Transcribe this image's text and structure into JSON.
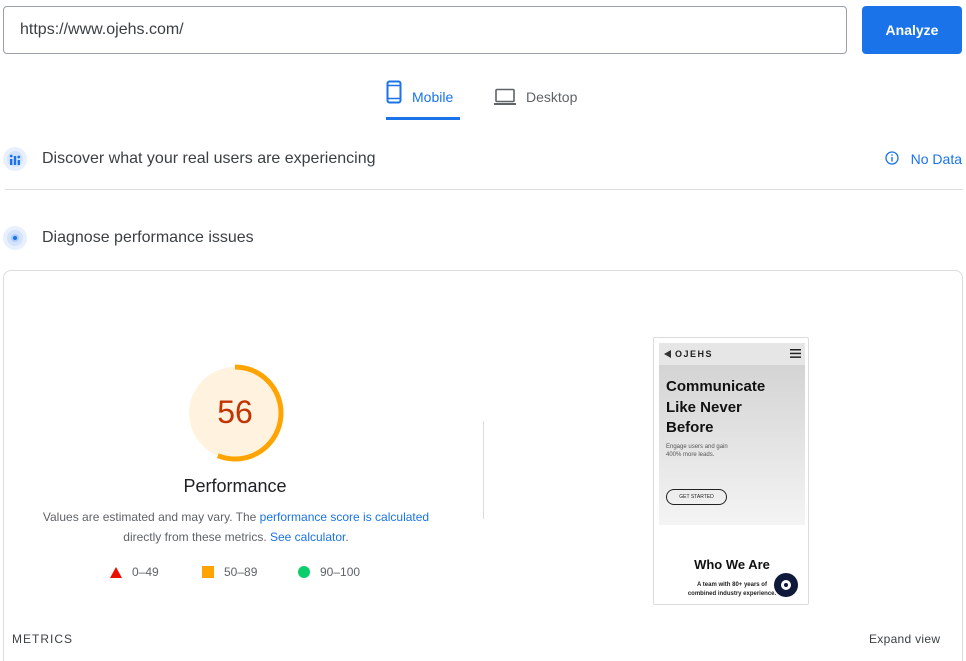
{
  "search": {
    "url": "https://www.ojehs.com/",
    "analyze_label": "Analyze"
  },
  "tabs": [
    {
      "label": "Mobile",
      "icon": "smartphone-icon",
      "active": true
    },
    {
      "label": "Desktop",
      "icon": "laptop-icon",
      "active": false
    }
  ],
  "crux": {
    "title": "Discover what your real users are experiencing",
    "status": "No Data"
  },
  "diagnose": {
    "title": "Diagnose performance issues"
  },
  "performance": {
    "score": "56",
    "score_value": 56,
    "label": "Performance",
    "disclaimer_pre": "Values are estimated and may vary. The ",
    "disclaimer_link1": "performance score is calculated",
    "disclaimer_mid": "directly from these metrics. ",
    "disclaimer_link2": "See calculator",
    "disclaimer_end": ".",
    "legend": [
      {
        "range": "0–49",
        "color": "#eb0f00",
        "shape": "triangle"
      },
      {
        "range": "50–89",
        "color": "#ffa400",
        "shape": "square"
      },
      {
        "range": "90–100",
        "color": "#0cce6b",
        "shape": "circle"
      }
    ]
  },
  "screenshot": {
    "logo": "OJEHS",
    "hero_title": [
      "Communicate",
      "Like Never",
      "Before"
    ],
    "hero_sub": [
      "Engage users and gain",
      "400% more leads."
    ],
    "cta": "GET STARTED",
    "section_title": "Who We Are",
    "section_sub": [
      "A team with 80+ years of",
      "combined industry experience."
    ]
  },
  "metrics": {
    "label": "METRICS",
    "expand": "Expand view"
  },
  "colors": {
    "accent": "#1a73e8",
    "score_orange": "#ffa400",
    "score_text": "#c33300"
  }
}
